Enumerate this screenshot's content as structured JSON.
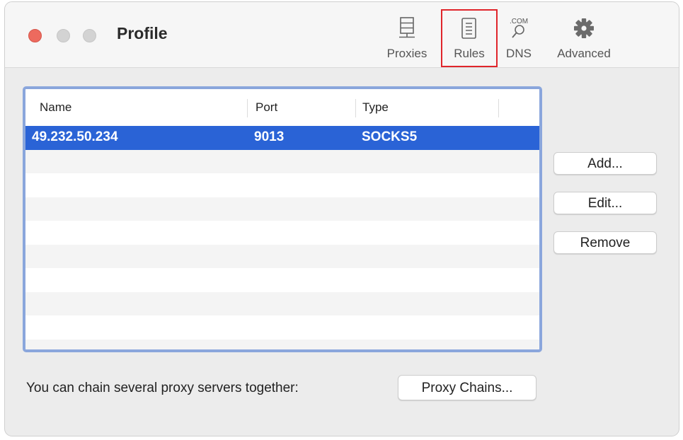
{
  "window": {
    "title": "Profile"
  },
  "toolbar": {
    "items": [
      {
        "label": "Proxies",
        "icon": "server-icon"
      },
      {
        "label": "Rules",
        "icon": "document-icon",
        "highlighted": true,
        "highlight_color": "#e0252b"
      },
      {
        "label": "DNS",
        "icon": "dns-com-icon",
        "icon_text": ".COM"
      },
      {
        "label": "Advanced",
        "icon": "gear-icon"
      }
    ]
  },
  "table": {
    "columns": [
      "Name",
      "Port",
      "Type"
    ],
    "rows": [
      {
        "name": "49.232.50.234",
        "port": "9013",
        "type": "SOCKS5",
        "selected": true
      }
    ],
    "selection_color": "#2a63d6",
    "focus_ring_color": "#8aa6dc"
  },
  "buttons": {
    "add": "Add...",
    "edit": "Edit...",
    "remove": "Remove",
    "proxy_chains": "Proxy Chains..."
  },
  "footer": {
    "chain_label": "You can chain several proxy servers together:"
  }
}
